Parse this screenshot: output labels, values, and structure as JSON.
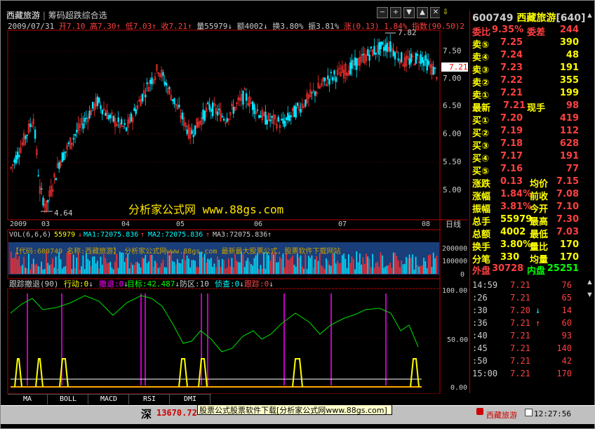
{
  "window": {
    "tab_left": "西藏旅游",
    "tab_formula": "筹码超跌综合选"
  },
  "info": {
    "date": "2009/07/31",
    "open_lbl": "开",
    "open": "7.10",
    "high_lbl": "高",
    "high": "7.30",
    "low_lbl": "低",
    "low": "7.03",
    "close_lbl": "收",
    "close": "7.21",
    "vol_lbl": "量",
    "vol": "55979",
    "amt_lbl": "额",
    "amt": "4002",
    "turn_lbl": "换",
    "turn": "3.80%",
    "amp_lbl": "振",
    "amp": "3.81%",
    "chg_lbl": "涨",
    "chg": "(0.13)",
    "chg_pct": "1.84%",
    "idx_lbl": "指数",
    "idx": "(90.50)",
    "idx_tail": "2"
  },
  "main_chart": {
    "y_ticks": [
      "7.50",
      "7.00",
      "6.50",
      "6.00",
      "5.50",
      "5.00"
    ],
    "current_price": "7.21",
    "high_mark": "7.82",
    "low_mark": "4.64",
    "x_ticks": [
      "2009",
      "03",
      "04",
      "05",
      "06",
      "07",
      "08"
    ],
    "period_label": "日线",
    "watermark": "分析家公式网 www.88gs.com"
  },
  "vol_panel": {
    "title": "VOL(6,6,6)",
    "v": "55979",
    "ma1": "MA1:72075.836",
    "ma2": "MA2:72075.836",
    "ma3": "MA3:72075.836",
    "banner": "【代码:600749 名称:西藏旅游】 分析家公式网www.88gs.com 最新最大股票公式，股票软件下载网站",
    "y_ticks": [
      "200000",
      "100000",
      "0"
    ]
  },
  "ind_panel": {
    "title": "跟踪撤退(90)",
    "p1_lbl": "行动:",
    "p1": "0",
    "p2_lbl": "撤退:",
    "p2": "0",
    "p3_lbl": "目标:",
    "p3": "42.487",
    "p4_lbl": "防区:",
    "p4": "10",
    "p5_lbl": "侦查:",
    "p5": "0",
    "p6_lbl": "跟踪:",
    "p6": "0",
    "y_ticks": [
      "100.00",
      "50.00",
      "0.00"
    ]
  },
  "bottom_tabs": [
    "MA",
    "BOLL",
    "MACD",
    "RSI",
    "DMI"
  ],
  "status": {
    "market": "深",
    "index_value": "13670.72",
    "scroll_text": "股票公式股票软件下载[分析家公式网www.88gs.com]",
    "stock": "西藏旅游",
    "time": "12:27:56"
  },
  "quote": {
    "code": "600749",
    "name": "西藏旅游",
    "code_suffix": "[640]",
    "weibi_lbl": "委比",
    "weibi": "9.35%",
    "weicha_lbl": "委差",
    "weicha": "244",
    "asks": [
      {
        "lbl": "卖⑤",
        "price": "7.25",
        "vol": "390"
      },
      {
        "lbl": "卖④",
        "price": "7.24",
        "vol": "48"
      },
      {
        "lbl": "卖③",
        "price": "7.23",
        "vol": "191"
      },
      {
        "lbl": "卖②",
        "price": "7.22",
        "vol": "355"
      },
      {
        "lbl": "卖①",
        "price": "7.21",
        "vol": "199"
      }
    ],
    "last_lbl": "最新",
    "last": "7.21",
    "xianshou_lbl": "现手",
    "xianshou": "98",
    "bids": [
      {
        "lbl": "买①",
        "price": "7.20",
        "vol": "419"
      },
      {
        "lbl": "买②",
        "price": "7.19",
        "vol": "112"
      },
      {
        "lbl": "买③",
        "price": "7.18",
        "vol": "628"
      },
      {
        "lbl": "买④",
        "price": "7.17",
        "vol": "191"
      },
      {
        "lbl": "买⑤",
        "price": "7.16",
        "vol": "77"
      }
    ],
    "stats": [
      {
        "l1": "涨跌",
        "v1": "0.13",
        "l2": "均价",
        "v2": "7.15"
      },
      {
        "l1": "涨幅",
        "v1": "1.84%",
        "l2": "前收",
        "v2": "7.08"
      },
      {
        "l1": "振幅",
        "v1": "3.81%",
        "l2": "今开",
        "v2": "7.10"
      },
      {
        "l1": "总手",
        "v1": "55979",
        "l2": "最高",
        "v2": "7.30"
      },
      {
        "l1": "总额",
        "v1": "4002",
        "l2": "最低",
        "v2": "7.03"
      },
      {
        "l1": "换手",
        "v1": "3.80%",
        "l2": "量比",
        "v2": "170"
      },
      {
        "l1": "分笔",
        "v1": "330",
        "l2": "均量",
        "v2": "170"
      }
    ],
    "outer_lbl": "外盘",
    "outer": "30728",
    "inner_lbl": "内盘",
    "inner": "25251",
    "ticks": [
      {
        "t": "14:59",
        "p": "7.21",
        "arrow": "",
        "v": "76"
      },
      {
        "t": ":26",
        "p": "7.21",
        "arrow": "",
        "v": "65"
      },
      {
        "t": ":30",
        "p": "7.20",
        "arrow": "↓",
        "v": "14"
      },
      {
        "t": ":36",
        "p": "7.21",
        "arrow": "↑",
        "v": "60"
      },
      {
        "t": ":40",
        "p": "7.21",
        "arrow": "",
        "v": "93"
      },
      {
        "t": ":45",
        "p": "7.21",
        "arrow": "",
        "v": "140"
      },
      {
        "t": ":50",
        "p": "7.21",
        "arrow": "",
        "v": "42"
      },
      {
        "t": "15:00",
        "p": "7.21",
        "arrow": "",
        "v": "170"
      }
    ]
  }
}
